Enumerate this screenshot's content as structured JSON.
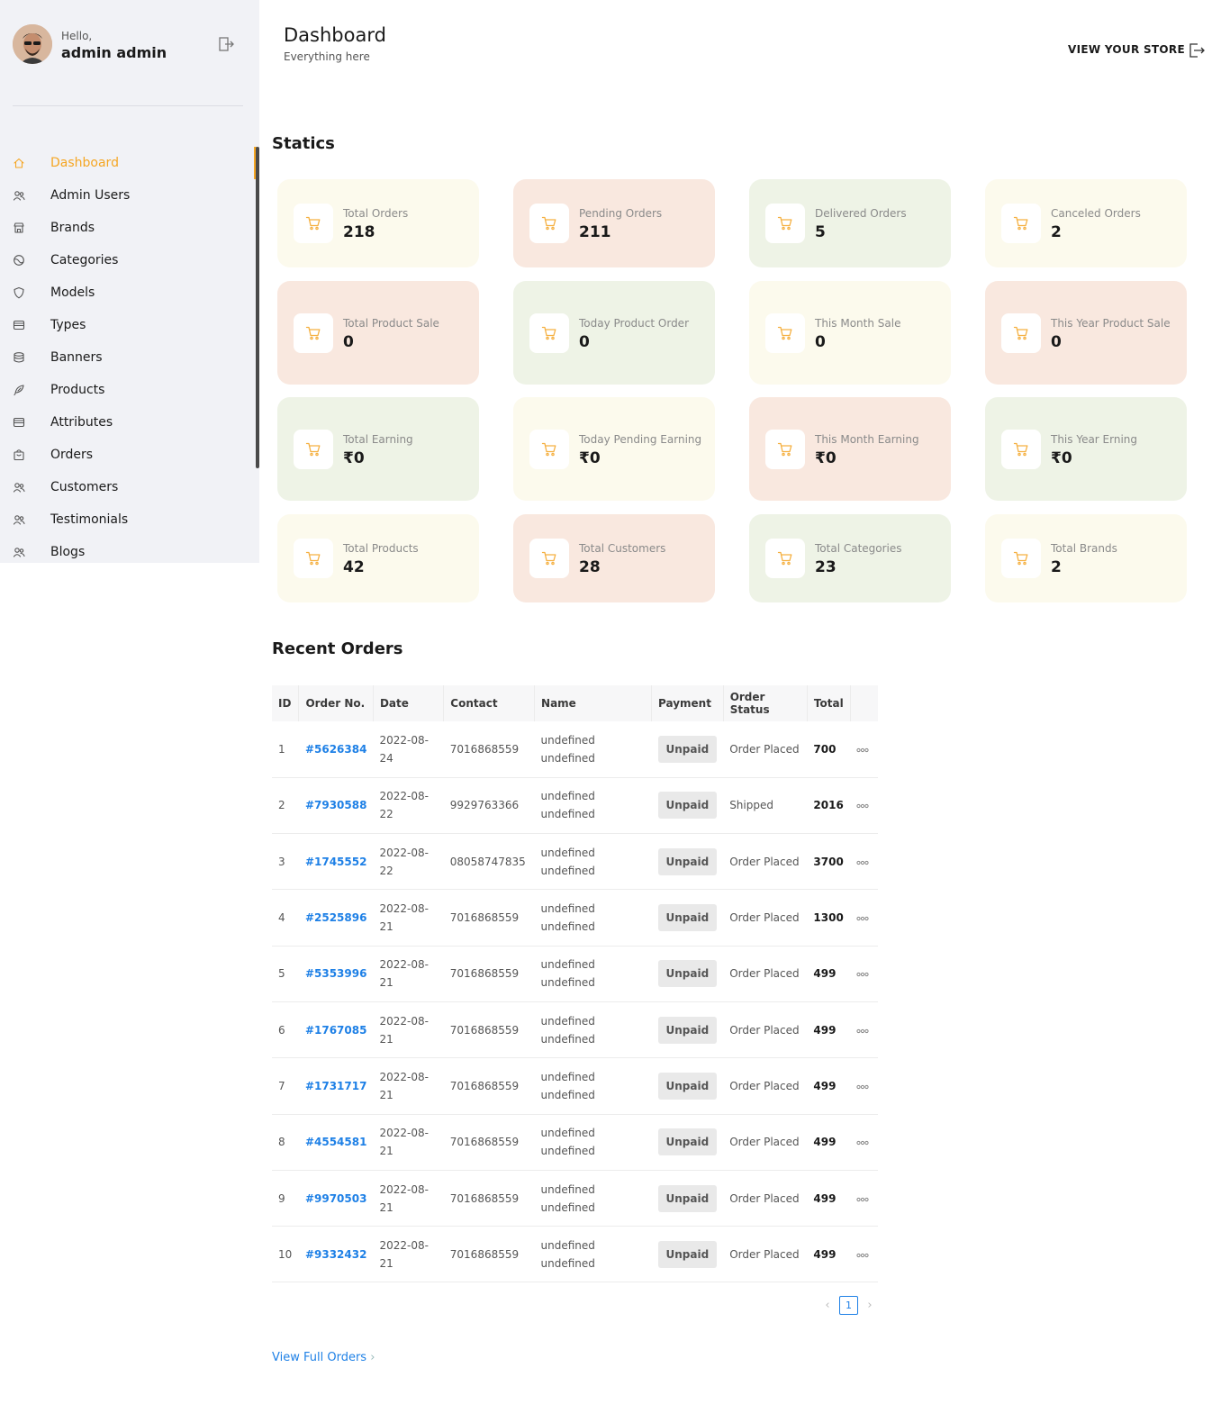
{
  "sidebar": {
    "greeting": "Hello,",
    "username": "admin admin",
    "items": [
      {
        "label": "Dashboard",
        "icon": "home-icon",
        "active": true
      },
      {
        "label": "Admin Users",
        "icon": "users-icon"
      },
      {
        "label": "Brands",
        "icon": "store-icon"
      },
      {
        "label": "Categories",
        "icon": "globe-icon"
      },
      {
        "label": "Models",
        "icon": "shield-icon"
      },
      {
        "label": "Types",
        "icon": "drive-icon"
      },
      {
        "label": "Banners",
        "icon": "database-icon"
      },
      {
        "label": "Products",
        "icon": "feather-icon"
      },
      {
        "label": "Attributes",
        "icon": "drive-icon"
      },
      {
        "label": "Orders",
        "icon": "bag-icon"
      },
      {
        "label": "Customers",
        "icon": "users-icon"
      },
      {
        "label": "Testimonials",
        "icon": "users-icon"
      },
      {
        "label": "Blogs",
        "icon": "users-icon"
      }
    ]
  },
  "header": {
    "title": "Dashboard",
    "subtitle": "Everything here",
    "view_store": "VIEW YOUR STORE"
  },
  "statics": {
    "title": "Statics",
    "cards": [
      {
        "label": "Total Orders",
        "value": "218"
      },
      {
        "label": "Pending Orders",
        "value": "211"
      },
      {
        "label": "Delivered Orders",
        "value": "5"
      },
      {
        "label": "Canceled Orders",
        "value": "2"
      },
      {
        "label": "Total Product Sale",
        "value": "0"
      },
      {
        "label": "Today Product Order",
        "value": "0"
      },
      {
        "label": "This Month Sale",
        "value": "0"
      },
      {
        "label": "This Year Product Sale",
        "value": "0"
      },
      {
        "label": "Total Earning",
        "value": "₹0"
      },
      {
        "label": "Today Pending Earning",
        "value": "₹0"
      },
      {
        "label": "This Month Earning",
        "value": "₹0"
      },
      {
        "label": "This Year Erning",
        "value": "₹0"
      },
      {
        "label": "Total Products",
        "value": "42"
      },
      {
        "label": "Total Customers",
        "value": "28"
      },
      {
        "label": "Total Categories",
        "value": "23"
      },
      {
        "label": "Total Brands",
        "value": "2"
      }
    ]
  },
  "recent_orders": {
    "title": "Recent Orders",
    "columns": [
      "ID",
      "Order No.",
      "Date",
      "Contact",
      "Name",
      "Payment",
      "Order Status",
      "Total"
    ],
    "rows": [
      {
        "id": "1",
        "order_no": "#5626384",
        "date": "2022-08-24",
        "contact": "7016868559",
        "name": "undefined undefined",
        "payment": "Unpaid",
        "status": "Order Placed",
        "total": "700"
      },
      {
        "id": "2",
        "order_no": "#7930588",
        "date": "2022-08-22",
        "contact": "9929763366",
        "name": "undefined undefined",
        "payment": "Unpaid",
        "status": "Shipped",
        "total": "2016"
      },
      {
        "id": "3",
        "order_no": "#1745552",
        "date": "2022-08-22",
        "contact": "08058747835",
        "name": "undefined undefined",
        "payment": "Unpaid",
        "status": "Order Placed",
        "total": "3700"
      },
      {
        "id": "4",
        "order_no": "#2525896",
        "date": "2022-08-21",
        "contact": "7016868559",
        "name": "undefined undefined",
        "payment": "Unpaid",
        "status": "Order Placed",
        "total": "1300"
      },
      {
        "id": "5",
        "order_no": "#5353996",
        "date": "2022-08-21",
        "contact": "7016868559",
        "name": "undefined undefined",
        "payment": "Unpaid",
        "status": "Order Placed",
        "total": "499"
      },
      {
        "id": "6",
        "order_no": "#1767085",
        "date": "2022-08-21",
        "contact": "7016868559",
        "name": "undefined undefined",
        "payment": "Unpaid",
        "status": "Order Placed",
        "total": "499"
      },
      {
        "id": "7",
        "order_no": "#1731717",
        "date": "2022-08-21",
        "contact": "7016868559",
        "name": "undefined undefined",
        "payment": "Unpaid",
        "status": "Order Placed",
        "total": "499"
      },
      {
        "id": "8",
        "order_no": "#4554581",
        "date": "2022-08-21",
        "contact": "7016868559",
        "name": "undefined undefined",
        "payment": "Unpaid",
        "status": "Order Placed",
        "total": "499"
      },
      {
        "id": "9",
        "order_no": "#9970503",
        "date": "2022-08-21",
        "contact": "7016868559",
        "name": "undefined undefined",
        "payment": "Unpaid",
        "status": "Order Placed",
        "total": "499"
      },
      {
        "id": "10",
        "order_no": "#9332432",
        "date": "2022-08-21",
        "contact": "7016868559",
        "name": "undefined undefined",
        "payment": "Unpaid",
        "status": "Order Placed",
        "total": "499"
      }
    ],
    "current_page": "1",
    "view_full": "View Full Orders"
  },
  "colors": {
    "accent": "#f5a623",
    "link": "#1e80e6",
    "sidebar_bg": "#f1f2f6",
    "card_cream": "#fcfaed",
    "card_pink": "#f9e8df",
    "card_green": "#eef3e6"
  }
}
